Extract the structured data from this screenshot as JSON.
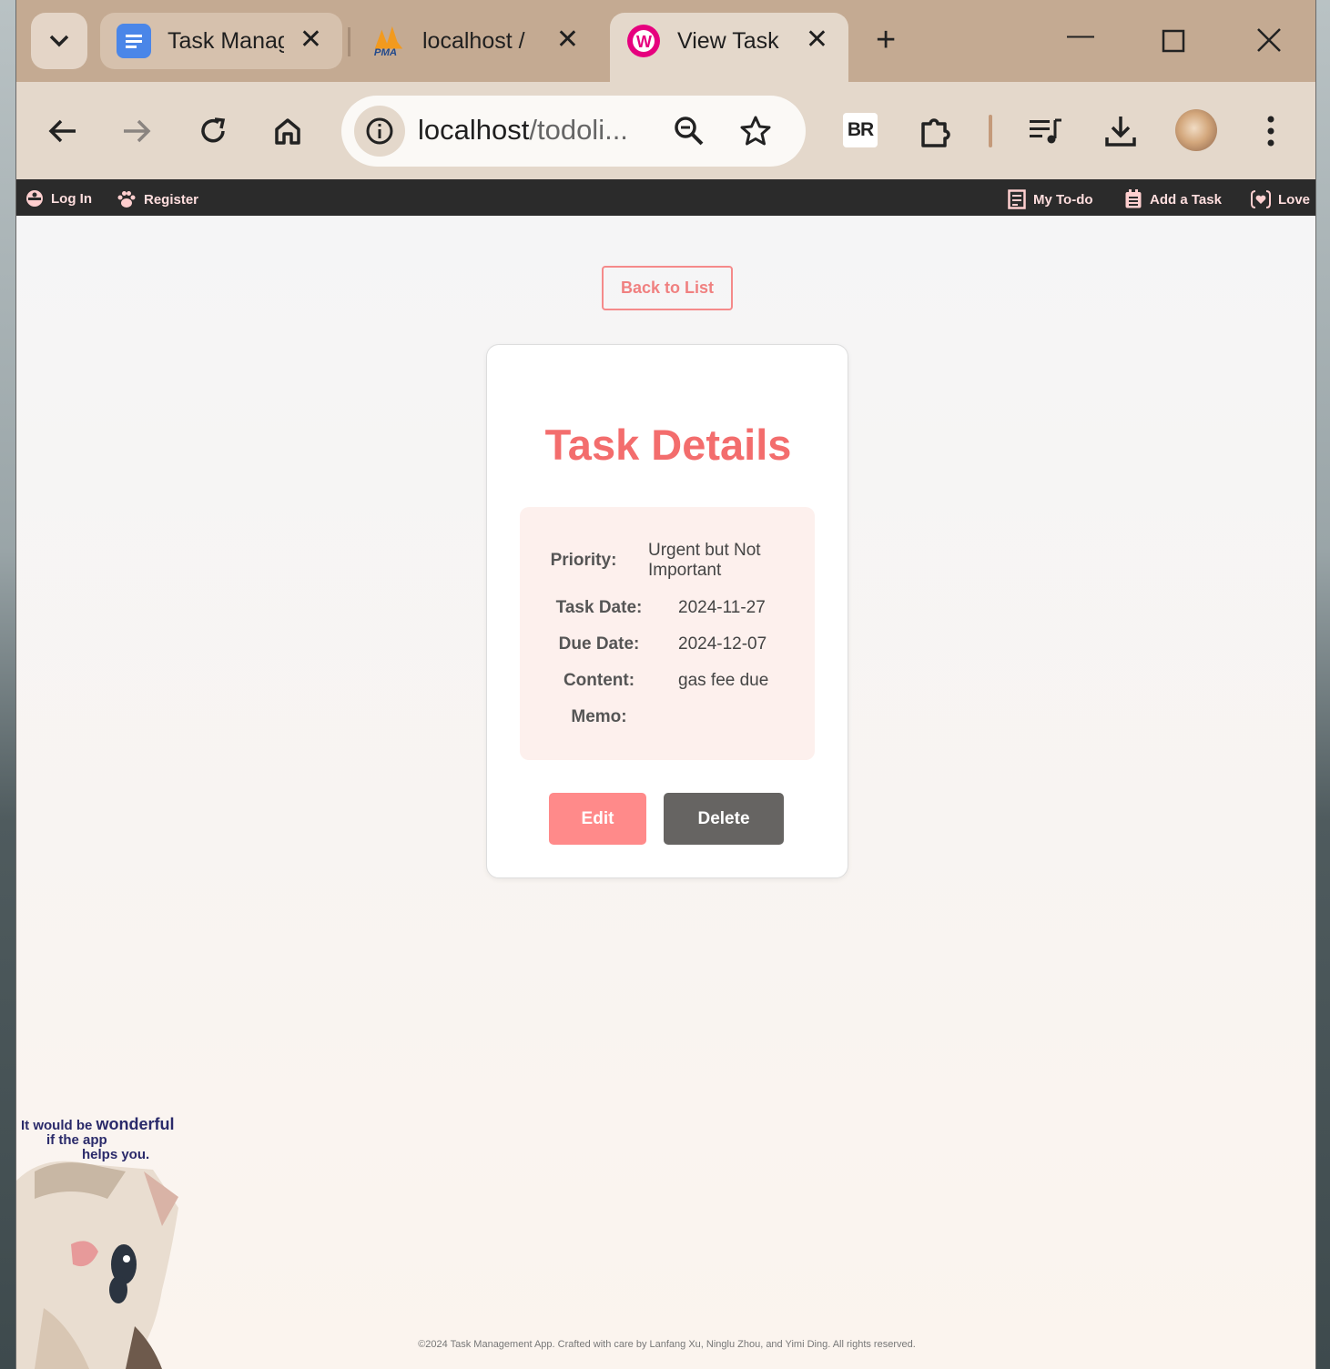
{
  "tabs": [
    {
      "title": "Task Manag",
      "icon": "google-docs-icon"
    },
    {
      "title": "localhost /",
      "icon": "phpmyadmin-icon"
    },
    {
      "title": "View Task",
      "icon": "wampserver-icon"
    }
  ],
  "omnibox": {
    "url_host": "localhost",
    "url_path": "/todoli..."
  },
  "extension_badge": "BR",
  "site_nav": {
    "login": "Log In",
    "register": "Register",
    "my_todo": "My To-do",
    "add_task": "Add a Task",
    "love": "Love"
  },
  "back_button": "Back to List",
  "card": {
    "title": "Task Details",
    "fields": [
      {
        "label": "Priority:",
        "value": "Urgent but Not Important"
      },
      {
        "label": "Task Date:",
        "value": "2024-11-27"
      },
      {
        "label": "Due Date:",
        "value": "2024-12-07"
      },
      {
        "label": "Content:",
        "value": "gas fee due"
      },
      {
        "label": "Memo:",
        "value": ""
      }
    ],
    "edit_label": "Edit",
    "delete_label": "Delete"
  },
  "sticker": {
    "line1": "It would be",
    "line1b": "wonderful",
    "line2": "if the app",
    "line3": "helps you."
  },
  "footer": "©2024 Task Management App. Crafted with care by Lanfang Xu, Ninglu Zhou, and Yimi Ding. All rights reserved.",
  "colors": {
    "accent": "#f36d6d",
    "tabstrip": "#c4aa92",
    "toolbar": "#e4d8cb",
    "navbar": "#2b2b2b",
    "delete": "#666462"
  }
}
